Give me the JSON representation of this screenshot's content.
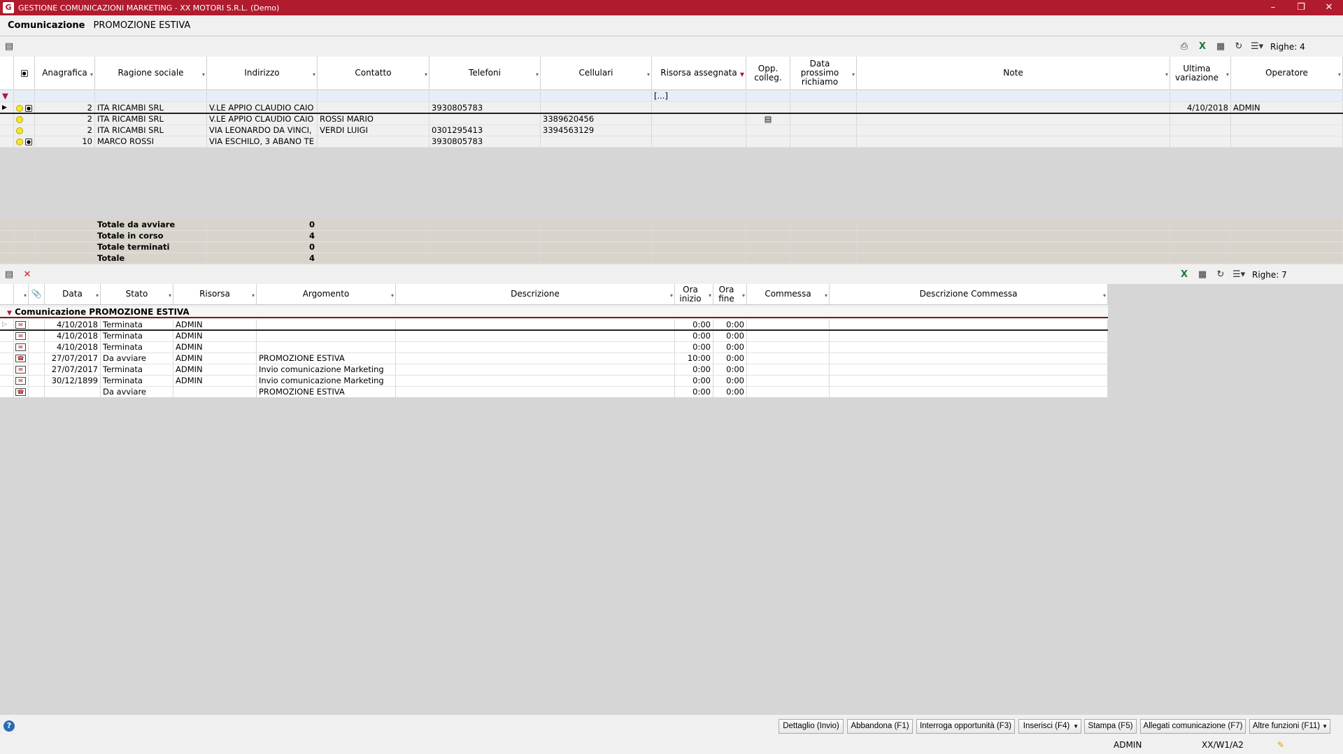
{
  "window": {
    "title": "GESTIONE COMUNICAZIONI MARKETING - XX  MOTORI S.R.L.  (Demo)",
    "minimize": "–",
    "restore": "❐",
    "close": "✕"
  },
  "header": {
    "label": "Comunicazione",
    "value": "PROMOZIONE ESTIVA"
  },
  "top_toolbar": {
    "rows_label": "Righe: 4",
    "icons": [
      "filter-icon",
      "print-icon",
      "excel-icon",
      "grid-icon",
      "refresh-icon",
      "settings-icon"
    ]
  },
  "top_grid": {
    "columns": [
      "",
      "",
      "Anagrafica",
      "Ragione sociale",
      "Indirizzo",
      "Contatto",
      "Telefoni",
      "Cellulari",
      "Risorsa assegnata",
      "Opp. colleg.",
      "Data prossimo richiamo",
      "Note",
      "Ultima variazione",
      "Operatore"
    ],
    "filter_value": "[...]",
    "rows": [
      {
        "id": "2",
        "ragione": "ITA RICAMBI SRL",
        "indirizzo": "V.LE APPIO CLAUDIO CAIO",
        "contatto": "",
        "telefoni": "3930805783",
        "cellulari": "",
        "risorsa": "",
        "opp": "",
        "data": "",
        "note": "",
        "ultima": "4/10/2018",
        "operatore": "ADMIN",
        "lock": true
      },
      {
        "id": "2",
        "ragione": "ITA RICAMBI SRL",
        "indirizzo": "V.LE APPIO CLAUDIO CAIO",
        "contatto": "ROSSI MARIO",
        "telefoni": "",
        "cellulari": "3389620456",
        "risorsa": "",
        "opp": "▤",
        "data": "",
        "note": "",
        "ultima": "",
        "operatore": "",
        "lock": false
      },
      {
        "id": "2",
        "ragione": "ITA RICAMBI SRL",
        "indirizzo": "VIA LEONARDO DA VINCI,",
        "contatto": "VERDI LUIGI",
        "telefoni": "0301295413",
        "cellulari": "3394563129",
        "risorsa": "",
        "opp": "",
        "data": "",
        "note": "",
        "ultima": "",
        "operatore": "",
        "lock": false
      },
      {
        "id": "10",
        "ragione": "MARCO ROSSI",
        "indirizzo": "VIA ESCHILO, 3 ABANO TE",
        "contatto": "",
        "telefoni": "3930805783",
        "cellulari": "",
        "risorsa": "",
        "opp": "",
        "data": "",
        "note": "",
        "ultima": "",
        "operatore": "",
        "lock": true
      }
    ],
    "totals": [
      {
        "label": "Totale da avviare",
        "value": "0"
      },
      {
        "label": "Totale in corso",
        "value": "4"
      },
      {
        "label": "Totale terminati",
        "value": "0"
      },
      {
        "label": "Totale",
        "value": "4"
      }
    ]
  },
  "bottom_toolbar": {
    "rows_label": "Righe: 7"
  },
  "bottom_grid": {
    "columns": [
      "",
      "",
      "Data",
      "Stato",
      "Risorsa",
      "Argomento",
      "Descrizione",
      "Ora inizio",
      "Ora fine",
      "Commessa",
      "Descrizione Commessa"
    ],
    "group_label": "Comunicazione PROMOZIONE ESTIVA",
    "rows": [
      {
        "icon": "envelope-icon",
        "data": "4/10/2018",
        "stato": "Terminata",
        "risorsa": "ADMIN",
        "argomento": "",
        "descrizione": "",
        "inizio": "0:00",
        "fine": "0:00"
      },
      {
        "icon": "envelope-icon",
        "data": "4/10/2018",
        "stato": "Terminata",
        "risorsa": "ADMIN",
        "argomento": "",
        "descrizione": "",
        "inizio": "0:00",
        "fine": "0:00"
      },
      {
        "icon": "envelope-icon",
        "data": "4/10/2018",
        "stato": "Terminata",
        "risorsa": "ADMIN",
        "argomento": "",
        "descrizione": "",
        "inizio": "0:00",
        "fine": "0:00"
      },
      {
        "icon": "phone-icon",
        "data": "27/07/2017",
        "stato": "Da avviare",
        "risorsa": "ADMIN",
        "argomento": "PROMOZIONE ESTIVA",
        "descrizione": "",
        "inizio": "10:00",
        "fine": "0:00"
      },
      {
        "icon": "envelope-icon",
        "data": "27/07/2017",
        "stato": "Terminata",
        "risorsa": "ADMIN",
        "argomento": "Invio comunicazione Marketing",
        "descrizione": "",
        "inizio": "0:00",
        "fine": "0:00"
      },
      {
        "icon": "envelope-icon",
        "data": "30/12/1899",
        "stato": "Terminata",
        "risorsa": "ADMIN",
        "argomento": "Invio comunicazione Marketing",
        "descrizione": "",
        "inizio": "0:00",
        "fine": "0:00"
      },
      {
        "icon": "phone-icon",
        "data": "",
        "stato": "Da avviare",
        "risorsa": "",
        "argomento": "PROMOZIONE ESTIVA",
        "descrizione": "",
        "inizio": "0:00",
        "fine": "0:00"
      }
    ]
  },
  "buttons": [
    "Dettaglio (Invio)",
    "Abbandona (F1)",
    "Interroga opportunità (F3)",
    "Inserisci (F4)",
    "Stampa (F5)",
    "Allegati comunicazione (F7)",
    "Altre funzioni (F11)"
  ],
  "status": {
    "user": "ADMIN",
    "terminal": "XX/W1/A2",
    "help": "?"
  }
}
